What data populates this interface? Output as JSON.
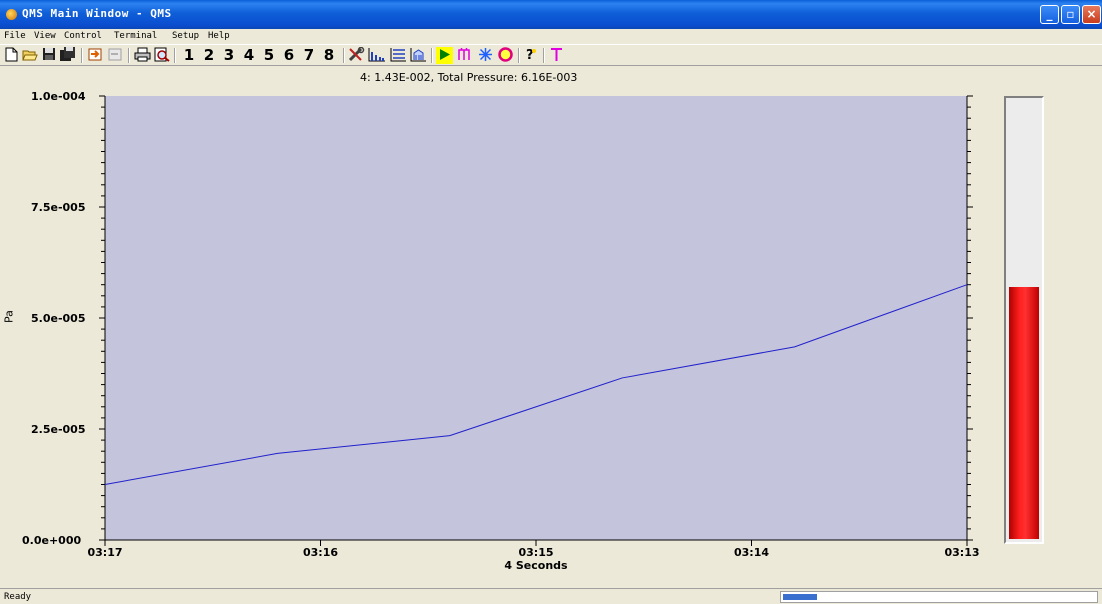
{
  "window": {
    "title": "QMS Main Window - QMS",
    "min_glyph": "_",
    "max_glyph": "▫",
    "close_glyph": "×"
  },
  "menu": [
    "File",
    "View",
    "Control",
    "Terminal",
    "Setup",
    "Help"
  ],
  "toolbar": {
    "icons": [
      "new-file-icon",
      "open-folder-icon",
      "save-icon",
      "save-all-icon",
      "import-icon",
      "export-icon",
      "print-icon",
      "print-preview-icon",
      "tools-icon",
      "bar-graph-icon",
      "list-icon",
      "table-icon",
      "play-icon",
      "scan-icon",
      "asterisk-icon",
      "circle-icon",
      "help-icon",
      "text-icon"
    ],
    "channels": [
      "1",
      "2",
      "3",
      "4",
      "5",
      "6",
      "7",
      "8"
    ]
  },
  "colors": {
    "plot_background": "#c4c4dc",
    "series_line": "#2020cc",
    "gauge_fill": "#ff2020"
  },
  "plot": {
    "title": "4: 1.43E-002, Total Pressure: 6.16E-003"
  },
  "chart_data": {
    "type": "line",
    "title": "4: 1.43E-002, Total Pressure: 6.16E-003",
    "xlabel": "4 Seconds",
    "ylabel": "Pa",
    "x_tick_labels": [
      "03:17",
      "03:16",
      "03:15",
      "03:14",
      "03:13"
    ],
    "y_tick_labels": [
      "0.0e+000",
      "2.5e-005",
      "5.0e-005",
      "7.5e-005",
      "1.0e-004"
    ],
    "ylim": [
      0,
      0.0001
    ],
    "grid": false,
    "x_positions": [
      0,
      0.8,
      1.6,
      2.4,
      3.2,
      4.0
    ],
    "series": [
      {
        "values": [
          1.25e-05,
          1.95e-05,
          2.35e-05,
          3.65e-05,
          4.35e-05,
          5.75e-05
        ]
      }
    ]
  },
  "gauge": {
    "level_fraction": 0.575
  },
  "status": {
    "text": "Ready",
    "progress_fraction": 0.11
  }
}
